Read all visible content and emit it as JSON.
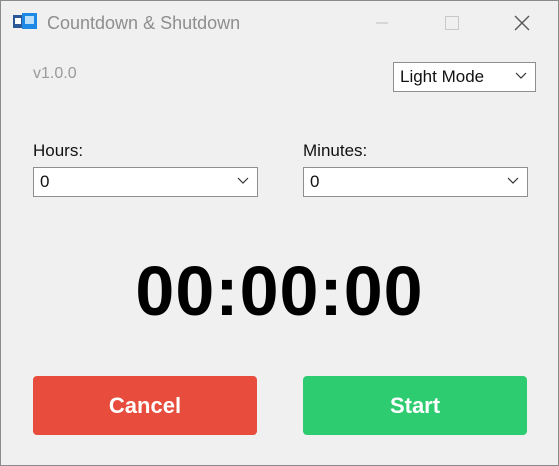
{
  "window": {
    "title": "Countdown & Shutdown",
    "icon": "app-window-icon"
  },
  "controls": {
    "minimize_icon": "minimize-icon",
    "maximize_icon": "maximize-icon",
    "close_icon": "close-icon"
  },
  "version": "v1.0.0",
  "theme_select": {
    "value": "Light Mode"
  },
  "hours": {
    "label": "Hours:",
    "value": "0"
  },
  "minutes": {
    "label": "Minutes:",
    "value": "0"
  },
  "timer": {
    "display": "00:00:00"
  },
  "buttons": {
    "cancel_label": "Cancel",
    "cancel_color": "#e74c3c",
    "start_label": "Start",
    "start_color": "#2ecc71"
  }
}
